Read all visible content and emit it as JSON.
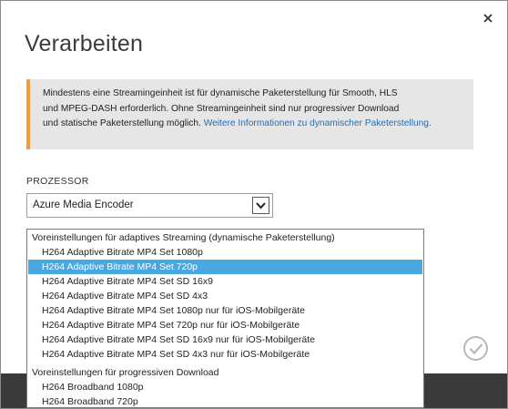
{
  "dialog": {
    "title": "Verarbeiten",
    "close_label": "×"
  },
  "info": {
    "line1": "Mindestens eine Streamingeinheit ist für dynamische Paketerstellung für Smooth, HLS",
    "line2": "und MPEG-DASH erforderlich. Ohne Streamingeinheit sind nur progressiver Download",
    "line3_text": "und statische Paketerstellung möglich. ",
    "link_text": "Weitere Informationen zu dynamischer Paketerstellung.",
    "accent_color": "#f39b38",
    "link_color": "#1f6fb8"
  },
  "processor": {
    "label": "PROZESSOR",
    "selected_value": "Azure Media Encoder"
  },
  "dropdown": {
    "groups": [
      {
        "header": "Voreinstellungen für adaptives Streaming (dynamische Paketerstellung)",
        "options": [
          "H264 Adaptive Bitrate MP4 Set 1080p",
          "H264 Adaptive Bitrate MP4 Set 720p",
          "H264 Adaptive Bitrate MP4 Set SD 16x9",
          "H264 Adaptive Bitrate MP4 Set SD 4x3",
          "H264 Adaptive Bitrate MP4 Set 1080p nur für iOS-Mobilgeräte",
          "H264 Adaptive Bitrate MP4 Set 720p nur für iOS-Mobilgeräte",
          "H264 Adaptive Bitrate MP4 Set SD 16x9 nur für iOS-Mobilgeräte",
          "H264 Adaptive Bitrate MP4 Set SD 4x3 nur für iOS-Mobilgeräte"
        ]
      },
      {
        "header": "Voreinstellungen für progressiven Download",
        "options": [
          "H264 Broadband 1080p",
          "H264 Broadband 720p"
        ]
      }
    ],
    "highlighted_option": "H264 Adaptive Bitrate MP4 Set 720p",
    "highlight_color": "#4aa8e0"
  },
  "icons": {
    "close": "close-icon",
    "dropdown_arrow": "chevron-down-icon",
    "confirm": "checkmark-icon"
  }
}
